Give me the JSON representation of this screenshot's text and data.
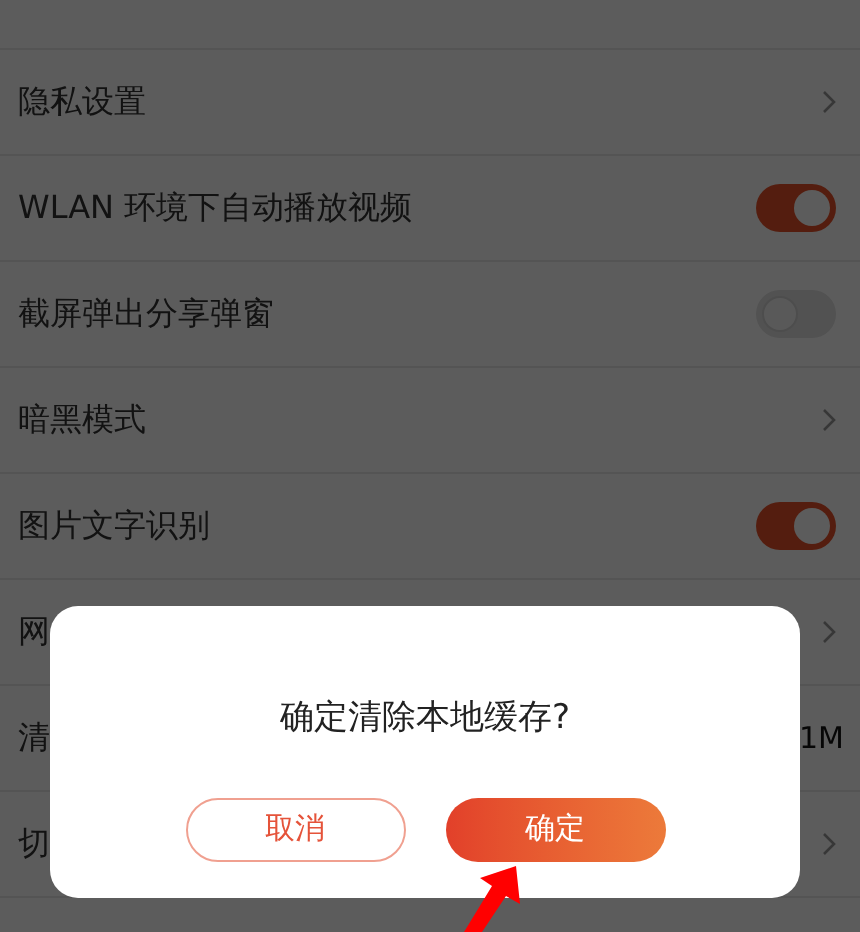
{
  "settings": [
    {
      "label": "隐私设置",
      "kind": "chevron"
    },
    {
      "label": "WLAN 环境下自动播放视频",
      "kind": "toggle",
      "on": true
    },
    {
      "label": "截屏弹出分享弹窗",
      "kind": "toggle",
      "on": false
    },
    {
      "label": "暗黑模式",
      "kind": "chevron"
    },
    {
      "label": "图片文字识别",
      "kind": "toggle",
      "on": true
    },
    {
      "label": "网",
      "kind": "chevron"
    },
    {
      "label": "清",
      "kind": "value",
      "value": "1M"
    },
    {
      "label": "切",
      "kind": "chevron"
    }
  ],
  "dialog": {
    "title": "确定清除本地缓存?",
    "buttons": [
      {
        "label": "取消",
        "kind": "secondary"
      },
      {
        "label": "确定",
        "kind": "primary"
      }
    ]
  }
}
